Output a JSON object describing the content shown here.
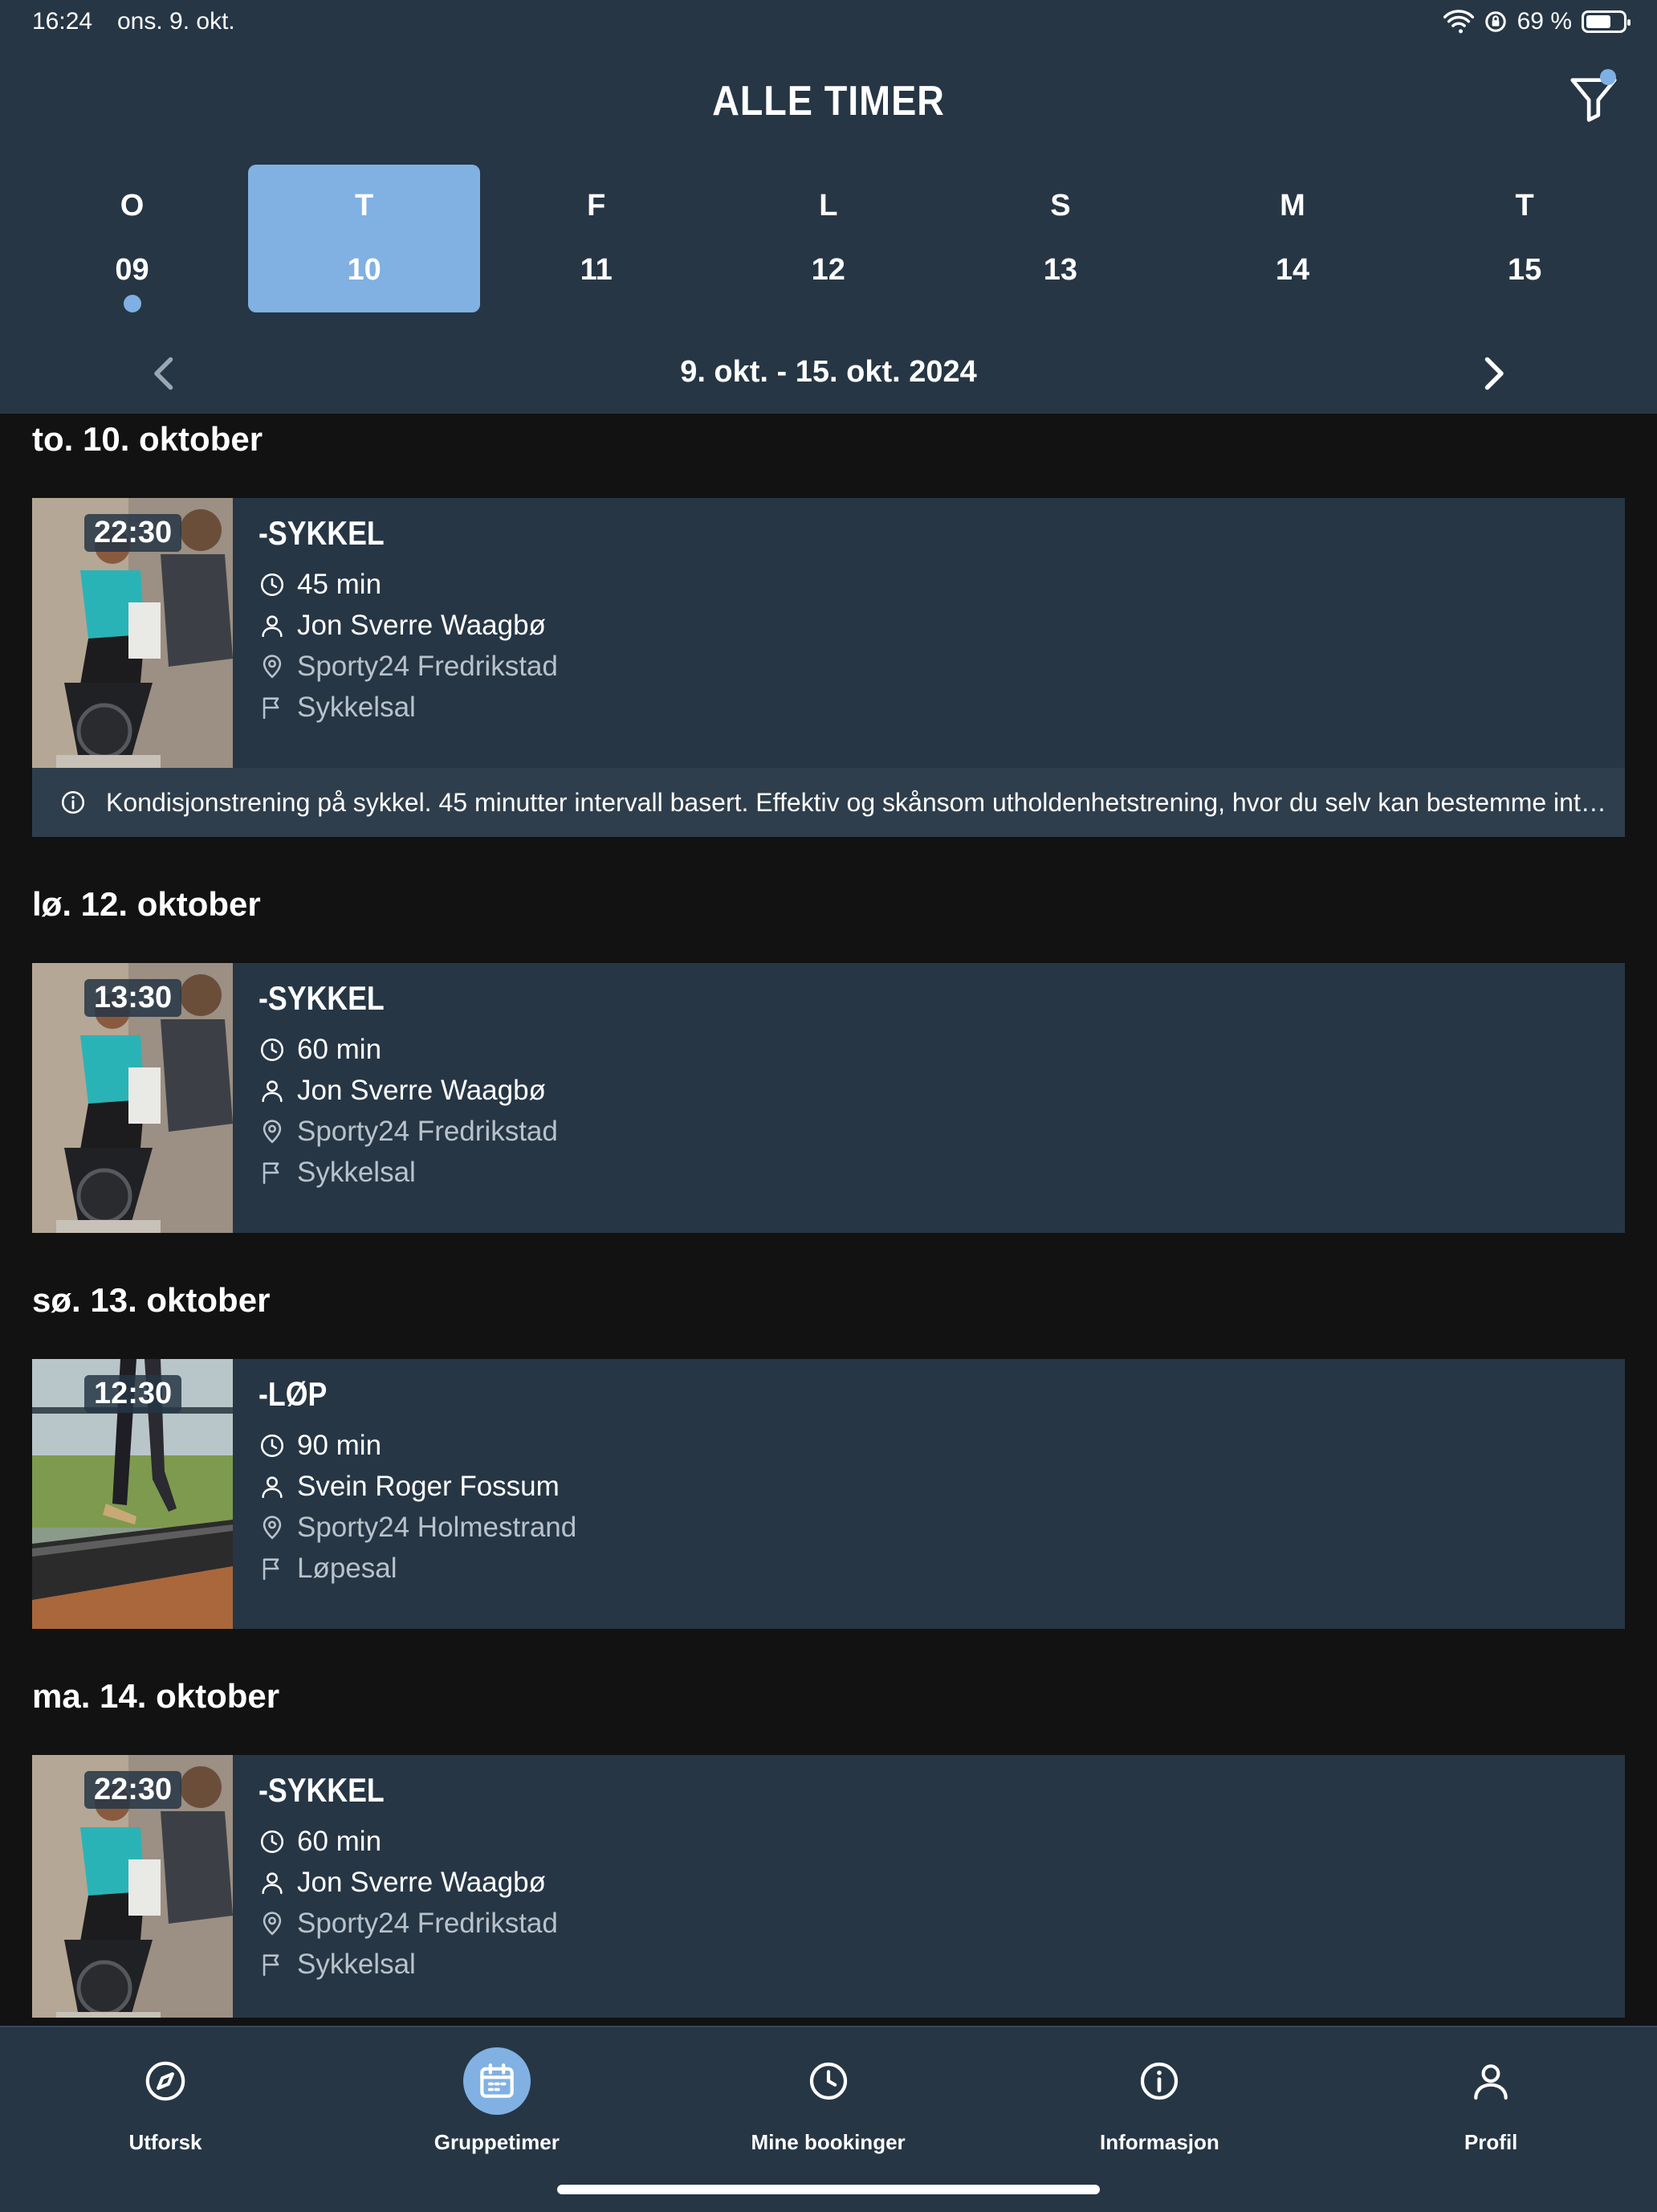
{
  "status_bar": {
    "time": "16:24",
    "date": "ons. 9. okt.",
    "battery": "69 %",
    "battery_level": 0.69
  },
  "header": {
    "title": "ALLE TIMER",
    "filter_active": true
  },
  "calendar": {
    "days": [
      {
        "letter": "O",
        "number": "09",
        "selected": false,
        "has_classes": true
      },
      {
        "letter": "T",
        "number": "10",
        "selected": true,
        "has_classes": false
      },
      {
        "letter": "F",
        "number": "11",
        "selected": false,
        "has_classes": false
      },
      {
        "letter": "L",
        "number": "12",
        "selected": false,
        "has_classes": false
      },
      {
        "letter": "S",
        "number": "13",
        "selected": false,
        "has_classes": false
      },
      {
        "letter": "M",
        "number": "14",
        "selected": false,
        "has_classes": false
      },
      {
        "letter": "T",
        "number": "15",
        "selected": false,
        "has_classes": false
      }
    ],
    "range": "9. okt. - 15. okt. 2024"
  },
  "schedule": [
    {
      "heading": "to. 10. oktober",
      "time": "22:30",
      "title": "-SYKKEL",
      "duration": "45 min",
      "instructor": "Jon Sverre Waagbø",
      "location": "Sporty24 Fredrikstad",
      "room": "Sykkelsal",
      "description": "Kondisjonstrening på sykkel. 45 minutter intervall basert. Effektiv og skånsom utholdenhetstrening, hvor du selv kan bestemme int…"
    },
    {
      "heading": "lø. 12. oktober",
      "time": "13:30",
      "title": "-SYKKEL",
      "duration": "60 min",
      "instructor": "Jon Sverre Waagbø",
      "location": "Sporty24 Fredrikstad",
      "room": "Sykkelsal"
    },
    {
      "heading": "sø. 13. oktober",
      "time": "12:30",
      "title": "-LØP",
      "duration": "90 min",
      "instructor": "Svein Roger Fossum",
      "location": "Sporty24 Holmestrand",
      "room": "Løpesal"
    },
    {
      "heading": "ma. 14. oktober",
      "time": "22:30",
      "title": "-SYKKEL",
      "duration": "60 min",
      "instructor": "Jon Sverre Waagbø",
      "location": "Sporty24 Fredrikstad",
      "room": "Sykkelsal"
    }
  ],
  "tabbar": {
    "tabs": [
      {
        "label": "Utforsk",
        "icon": "compass-icon",
        "active": false
      },
      {
        "label": "Gruppetimer",
        "icon": "calendar-icon",
        "active": true
      },
      {
        "label": "Mine bookinger",
        "icon": "clock-icon",
        "active": false
      },
      {
        "label": "Informasjon",
        "icon": "info-icon",
        "active": false
      },
      {
        "label": "Profil",
        "icon": "person-icon",
        "active": false
      }
    ]
  },
  "colors": {
    "header_bg": "#263645",
    "accent": "#80b1e2",
    "page_bg": "#121212",
    "card_bg": "#263645"
  }
}
